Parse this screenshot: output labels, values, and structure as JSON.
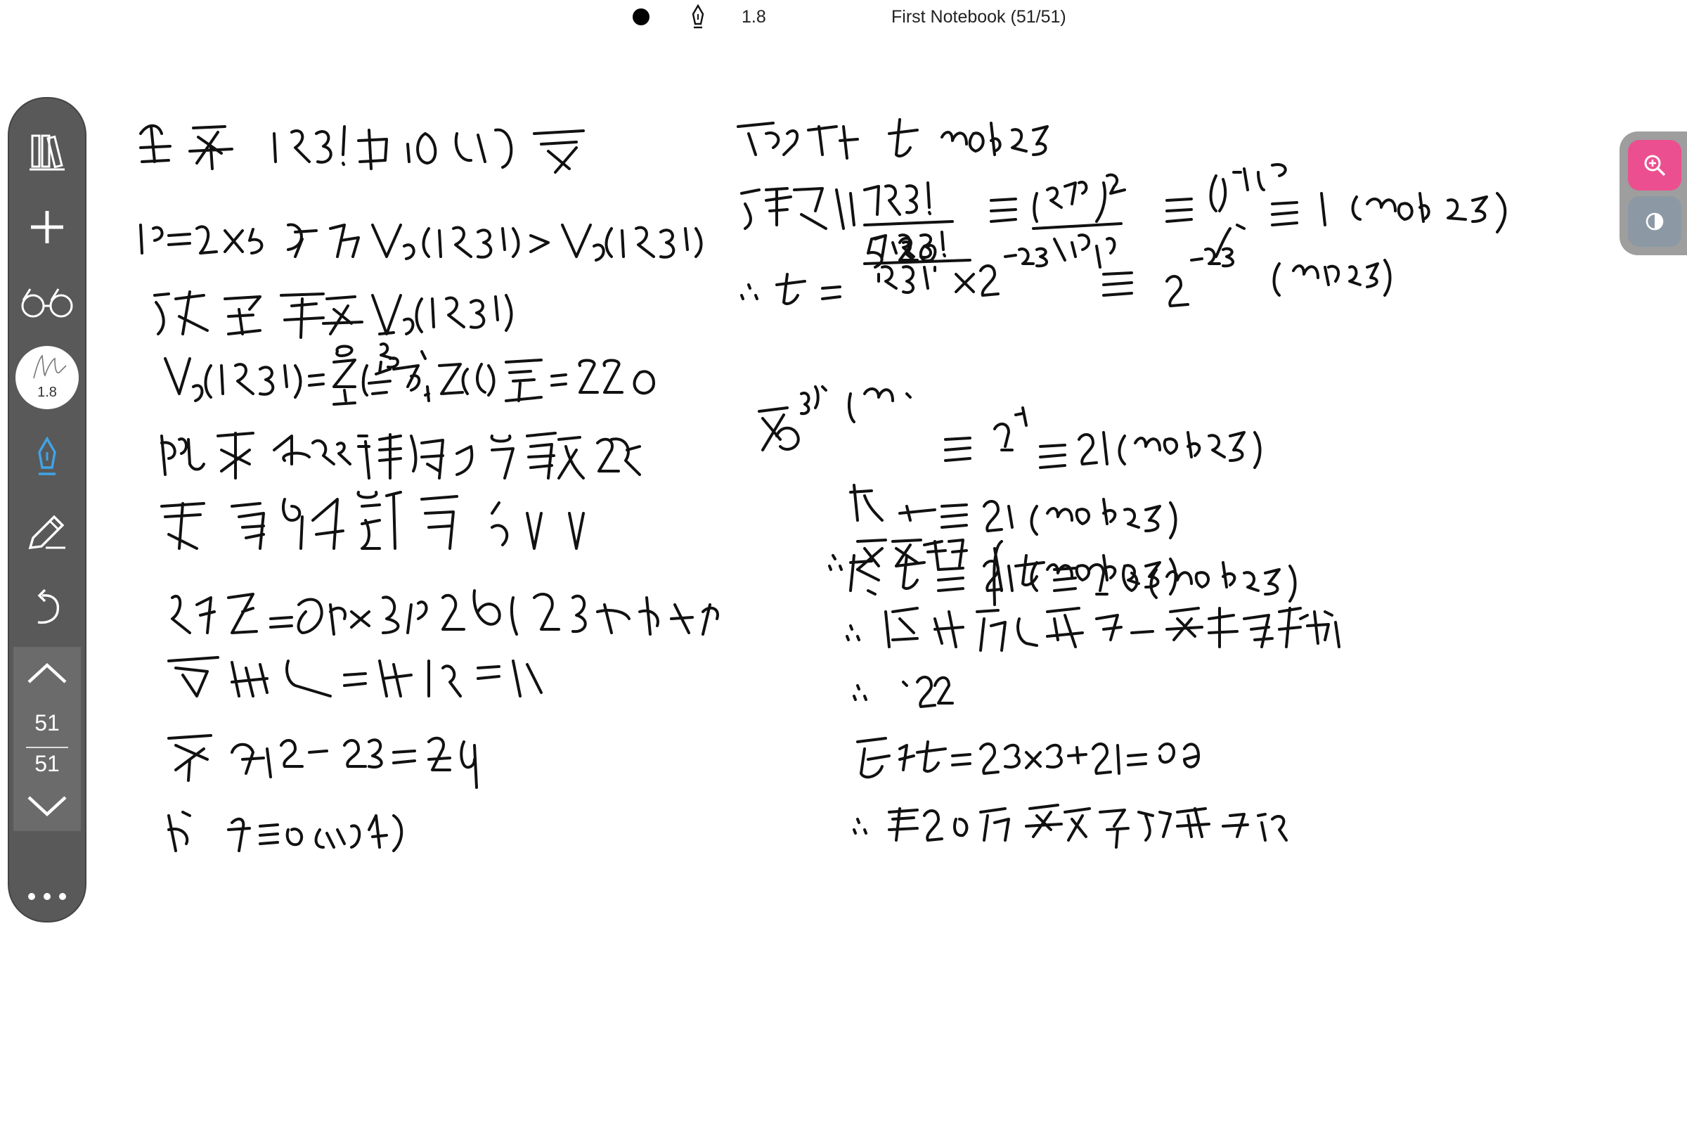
{
  "status_bar": {
    "pen_size": "1.8",
    "notebook_title": "First Notebook (51/51)"
  },
  "toolbar": {
    "items": [
      {
        "name": "library-icon"
      },
      {
        "name": "add-icon"
      },
      {
        "name": "glasses-icon"
      },
      {
        "name": "fountain-pen-icon"
      },
      {
        "name": "pencil-icon"
      },
      {
        "name": "undo-icon"
      }
    ],
    "pen_preview_size": "1.8",
    "current_page": "51",
    "total_pages": "51",
    "more_icon": "ellipsis-icon"
  },
  "right_toolbar": {
    "zoom_icon": "zoom-in-icon",
    "contrast_icon": "contrast-icon",
    "accent_color": "#ec4f8f"
  },
  "colors": {
    "toolbar_bg": "#595959",
    "active_tool": "#3fa4e8"
  }
}
